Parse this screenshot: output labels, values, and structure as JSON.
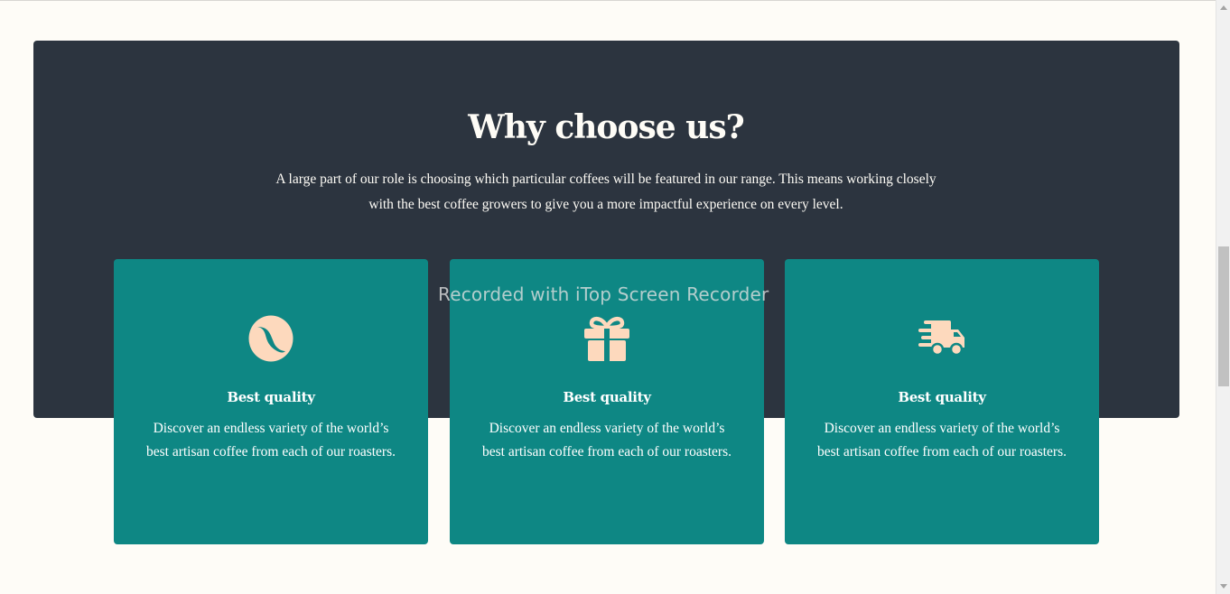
{
  "section": {
    "heading": "Why choose us?",
    "intro": "A large part of our role is choosing which particular coffees will be featured in our range. This means working closely with the best coffee growers to give you a more impactful experience on every level."
  },
  "cards": [
    {
      "icon": "coffee-bean-icon",
      "title": "Best quality",
      "description": "Discover an endless variety of the world’s best artisan coffee from each of our roasters."
    },
    {
      "icon": "gift-icon",
      "title": "Best quality",
      "description": "Discover an endless variety of the world’s best artisan coffee from each of our roasters."
    },
    {
      "icon": "delivery-truck-icon",
      "title": "Best quality",
      "description": "Discover an endless variety of the world’s best artisan coffee from each of our roasters."
    }
  ],
  "watermark": "Recorded with iTop Screen Recorder",
  "colors": {
    "page_background": "#fefcf7",
    "panel_background": "#2c343f",
    "card_background": "#0e8784",
    "icon_color": "#fdd9bd",
    "text_light": "#fefcf6"
  }
}
